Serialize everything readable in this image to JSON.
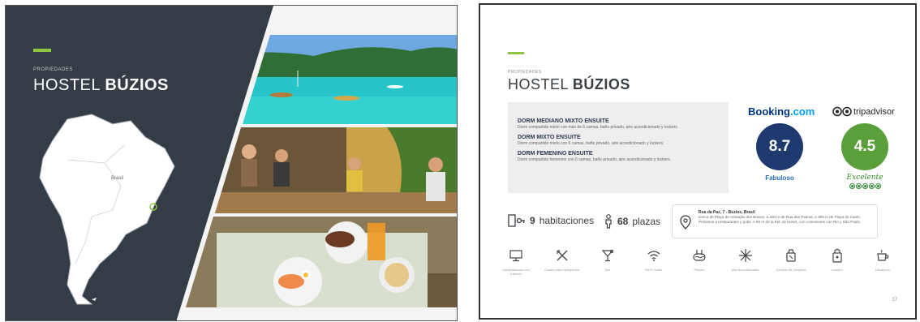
{
  "left_slide": {
    "eyebrow": "PROPIEDADES",
    "title_light": "HOSTEL",
    "title_bold": "BÚZIOS",
    "map_label": "Brasil",
    "photos": [
      "beach-photo",
      "hostel-lounge-photo",
      "breakfast-photo"
    ]
  },
  "right_slide": {
    "eyebrow": "PROPIEDADES",
    "title_light": "HOSTEL",
    "title_bold": "BÚZIOS",
    "rooms": [
      {
        "name": "DORM MEDIANO MIXTO ENSUITE",
        "desc": "Dorm compartido mixto con más de 6 camas, baño privado, aire acondicionado y lockers."
      },
      {
        "name": "DORM MIXTO ENSUITE",
        "desc": "Dorm compartido mixto con 6 camas, baño privado, aire acondicionado y lockers."
      },
      {
        "name": "DORM FEMENINO ENSUITE",
        "desc": "Dorm compartido femenino con 6 camas, baño privado, aire acondicionado y lockers."
      }
    ],
    "booking": {
      "brand": "Booking",
      "brand_suffix": ".com",
      "score": "8.7",
      "rating_label": "Fabuloso"
    },
    "tripadvisor": {
      "brand": "tripadvisor",
      "score": "4.5",
      "rating_label": "Excelente",
      "bubbles": 5
    },
    "stats": {
      "rooms_count": "9",
      "rooms_label": "habitaciones",
      "beds_count": "68",
      "beds_label": "plazas"
    },
    "address": {
      "title": "Rua da Paz, 7 - Búzios, Brasil",
      "text": "Cerca de Playa de Armação dos Búzios, a 200 m de Rua das Pedras, a 300 m de Playa do Canto. Próximos a restaurantes y pubs. A 50 m de la Est. de buses, con conexiones con Rio y São Paulo."
    },
    "amenities": [
      {
        "icon": "computer-icon",
        "label": "Computadoras con Internet"
      },
      {
        "icon": "kitchen-icon",
        "label": "Cocina para Huéspedes"
      },
      {
        "icon": "bar-icon",
        "label": "Bar"
      },
      {
        "icon": "wifi-icon",
        "label": "Wi-Fi Gratis"
      },
      {
        "icon": "pool-icon",
        "label": "Piscina"
      },
      {
        "icon": "ac-icon",
        "label": "Aire Acondicionado"
      },
      {
        "icon": "cleaning-icon",
        "label": "Servicio de Limpieza"
      },
      {
        "icon": "locker-icon",
        "label": "Lockers"
      },
      {
        "icon": "breakfast-icon",
        "label": "Desayuno"
      }
    ],
    "page_number": "17"
  },
  "colors": {
    "dark_panel": "#343d45",
    "accent": "#8dc63f",
    "booking_navy": "#1e3a6e",
    "tripadvisor_green": "#5a9f3a"
  }
}
